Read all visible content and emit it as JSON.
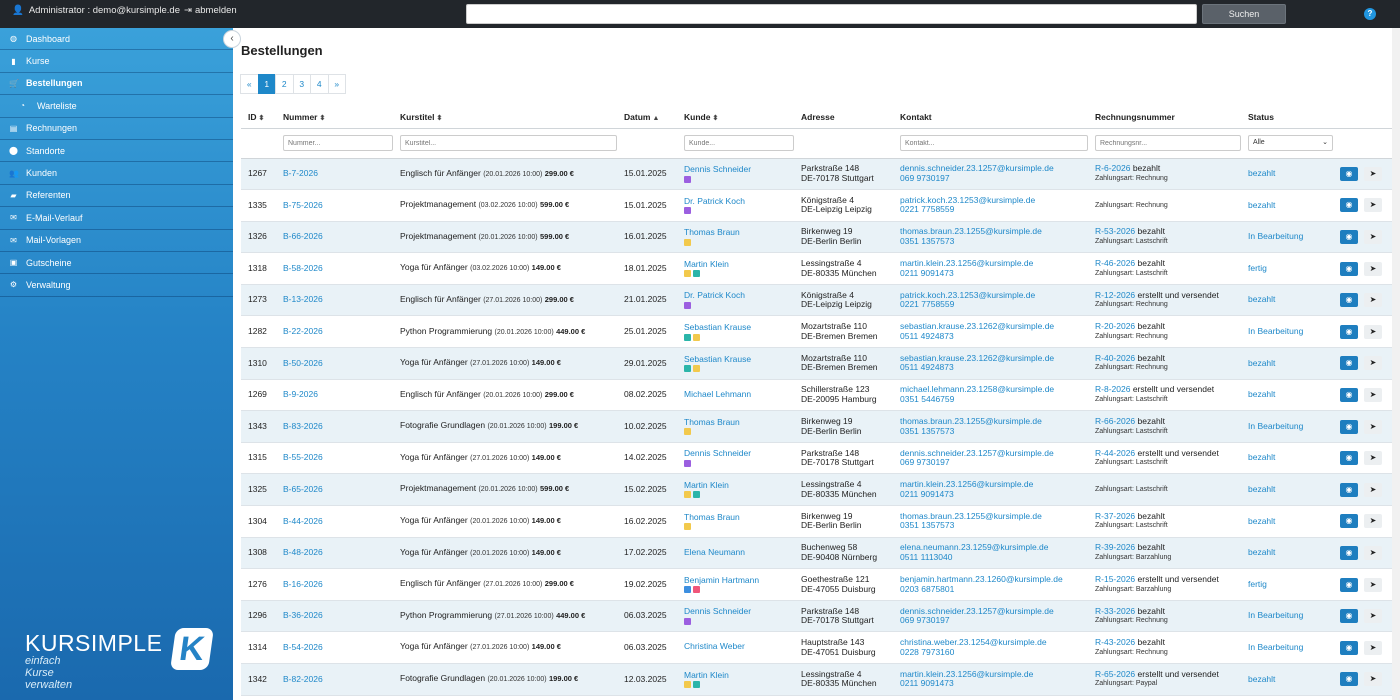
{
  "topbar": {
    "user": "Administrator : demo@kursimple.de",
    "logout": "abmelden",
    "search_value": "",
    "search_button": "Suchen",
    "help": "?"
  },
  "sidebar": {
    "items": [
      {
        "label": "Dashboard",
        "icon": "dashboard-icon",
        "glyph": "◍",
        "active": false,
        "sub": false
      },
      {
        "label": "Kurse",
        "icon": "book-icon",
        "glyph": "▮",
        "active": false,
        "sub": false
      },
      {
        "label": "Bestellungen",
        "icon": "cart-icon",
        "glyph": "🛒",
        "active": true,
        "sub": false
      },
      {
        "label": "Warteliste",
        "icon": "clock-icon",
        "glyph": "◔",
        "active": false,
        "sub": true
      },
      {
        "label": "Rechnungen",
        "icon": "invoice-icon",
        "glyph": "▤",
        "active": false,
        "sub": false
      },
      {
        "label": "Standorte",
        "icon": "location-pin-icon",
        "glyph": "⬤",
        "active": false,
        "sub": false
      },
      {
        "label": "Kunden",
        "icon": "users-icon",
        "glyph": "👥",
        "active": false,
        "sub": false
      },
      {
        "label": "Referenten",
        "icon": "teacher-icon",
        "glyph": "▰",
        "active": false,
        "sub": false
      },
      {
        "label": "E-Mail-Verlauf",
        "icon": "envelope-icon",
        "glyph": "✉",
        "active": false,
        "sub": false
      },
      {
        "label": "Mail-Vorlagen",
        "icon": "mail-template-icon",
        "glyph": "✉",
        "active": false,
        "sub": false
      },
      {
        "label": "Gutscheine",
        "icon": "gift-icon",
        "glyph": "▣",
        "active": false,
        "sub": false
      },
      {
        "label": "Verwaltung",
        "icon": "gear-icon",
        "glyph": "⚙",
        "active": false,
        "sub": false
      }
    ],
    "brand_name": "KURSIMPLE",
    "brand_tagline": "einfach Kurse verwalten",
    "brand_mark": "K"
  },
  "main": {
    "title": "Bestellungen",
    "pagination": [
      "«",
      "1",
      "2",
      "3",
      "4",
      "»"
    ],
    "current_page": "1",
    "columns": [
      "ID",
      "Nummer",
      "Kurstitel",
      "Datum",
      "Kunde",
      "Adresse",
      "Kontakt",
      "Rechnungsnummer",
      "Status"
    ],
    "filters": {
      "nummer": "Nummer...",
      "kurstitel": "Kurstitel...",
      "kunde": "Kunde...",
      "kontakt": "Kontakt...",
      "rechnung": "Rechnungsnr...",
      "status": "Alle"
    },
    "tag_colors": {
      "purple": "#9b5fe0",
      "yellow": "#f2c94c",
      "teal": "#2bb5a9",
      "blue": "#3d8fe0",
      "pink": "#f0567a"
    },
    "rows": [
      {
        "id": "1267",
        "nummer": "B-7-2026",
        "kurs": "Englisch für Anfänger",
        "kurs_datum": "(20.01.2026 10:00)",
        "preis": "299.00 €",
        "datum": "15.01.2025",
        "kunde": "Dennis Schneider",
        "tags": [
          "purple"
        ],
        "strasse": "Parkstraße 148",
        "ort": "DE-70178 Stuttgart",
        "email": "dennis.schneider.23.1257@kursimple.de",
        "telefon": "069 9730197",
        "rechnung": "R-6-2026",
        "rechnung_status": "bezahlt",
        "zahlungsart": "Zahlungsart: Rechnung",
        "status": "bezahlt"
      },
      {
        "id": "1335",
        "nummer": "B-75-2026",
        "kurs": "Projektmanagement",
        "kurs_datum": "(03.02.2026 10:00)",
        "preis": "599.00 €",
        "datum": "15.01.2025",
        "kunde": "Dr. Patrick Koch",
        "tags": [
          "purple"
        ],
        "strasse": "Königstraße 4",
        "ort": "DE-Leipzig Leipzig",
        "email": "patrick.koch.23.1253@kursimple.de",
        "telefon": "0221 7758559",
        "rechnung": "",
        "rechnung_status": "",
        "zahlungsart": "Zahlungsart: Rechnung",
        "status": "bezahlt"
      },
      {
        "id": "1326",
        "nummer": "B-66-2026",
        "kurs": "Projektmanagement",
        "kurs_datum": "(20.01.2026 10:00)",
        "preis": "599.00 €",
        "datum": "16.01.2025",
        "kunde": "Thomas Braun",
        "tags": [
          "yellow"
        ],
        "strasse": "Birkenweg 19",
        "ort": "DE-Berlin Berlin",
        "email": "thomas.braun.23.1255@kursimple.de",
        "telefon": "0351 1357573",
        "rechnung": "R-53-2026",
        "rechnung_status": "bezahlt",
        "zahlungsart": "Zahlungsart: Lastschrift",
        "status": "In Bearbeitung"
      },
      {
        "id": "1318",
        "nummer": "B-58-2026",
        "kurs": "Yoga für Anfänger",
        "kurs_datum": "(03.02.2026 10:00)",
        "preis": "149.00 €",
        "datum": "18.01.2025",
        "kunde": "Martin Klein",
        "tags": [
          "yellow",
          "teal"
        ],
        "strasse": "Lessingstraße 4",
        "ort": "DE-80335 München",
        "email": "martin.klein.23.1256@kursimple.de",
        "telefon": "0211 9091473",
        "rechnung": "R-46-2026",
        "rechnung_status": "bezahlt",
        "zahlungsart": "Zahlungsart: Lastschrift",
        "status": "fertig"
      },
      {
        "id": "1273",
        "nummer": "B-13-2026",
        "kurs": "Englisch für Anfänger",
        "kurs_datum": "(27.01.2026 10:00)",
        "preis": "299.00 €",
        "datum": "21.01.2025",
        "kunde": "Dr. Patrick Koch",
        "tags": [
          "purple"
        ],
        "strasse": "Königstraße 4",
        "ort": "DE-Leipzig Leipzig",
        "email": "patrick.koch.23.1253@kursimple.de",
        "telefon": "0221 7758559",
        "rechnung": "R-12-2026",
        "rechnung_status": "erstellt und versendet",
        "zahlungsart": "Zahlungsart: Rechnung",
        "status": "bezahlt"
      },
      {
        "id": "1282",
        "nummer": "B-22-2026",
        "kurs": "Python Programmierung",
        "kurs_datum": "(20.01.2026 10:00)",
        "preis": "449.00 €",
        "datum": "25.01.2025",
        "kunde": "Sebastian Krause",
        "tags": [
          "teal",
          "yellow"
        ],
        "strasse": "Mozartstraße 110",
        "ort": "DE-Bremen Bremen",
        "email": "sebastian.krause.23.1262@kursimple.de",
        "telefon": "0511 4924873",
        "rechnung": "R-20-2026",
        "rechnung_status": "bezahlt",
        "zahlungsart": "Zahlungsart: Rechnung",
        "status": "In Bearbeitung"
      },
      {
        "id": "1310",
        "nummer": "B-50-2026",
        "kurs": "Yoga für Anfänger",
        "kurs_datum": "(27.01.2026 10:00)",
        "preis": "149.00 €",
        "datum": "29.01.2025",
        "kunde": "Sebastian Krause",
        "tags": [
          "teal",
          "yellow"
        ],
        "strasse": "Mozartstraße 110",
        "ort": "DE-Bremen Bremen",
        "email": "sebastian.krause.23.1262@kursimple.de",
        "telefon": "0511 4924873",
        "rechnung": "R-40-2026",
        "rechnung_status": "bezahlt",
        "zahlungsart": "Zahlungsart: Rechnung",
        "status": "bezahlt"
      },
      {
        "id": "1269",
        "nummer": "B-9-2026",
        "kurs": "Englisch für Anfänger",
        "kurs_datum": "(20.01.2026 10:00)",
        "preis": "299.00 €",
        "datum": "08.02.2025",
        "kunde": "Michael Lehmann",
        "tags": [],
        "strasse": "Schillerstraße 123",
        "ort": "DE-20095 Hamburg",
        "email": "michael.lehmann.23.1258@kursimple.de",
        "telefon": "0351 5446759",
        "rechnung": "R-8-2026",
        "rechnung_status": "erstellt und versendet",
        "zahlungsart": "Zahlungsart: Lastschrift",
        "status": "bezahlt"
      },
      {
        "id": "1343",
        "nummer": "B-83-2026",
        "kurs": "Fotografie Grundlagen",
        "kurs_datum": "(20.01.2026 10:00)",
        "preis": "199.00 €",
        "datum": "10.02.2025",
        "kunde": "Thomas Braun",
        "tags": [
          "yellow"
        ],
        "strasse": "Birkenweg 19",
        "ort": "DE-Berlin Berlin",
        "email": "thomas.braun.23.1255@kursimple.de",
        "telefon": "0351 1357573",
        "rechnung": "R-66-2026",
        "rechnung_status": "bezahlt",
        "zahlungsart": "Zahlungsart: Lastschrift",
        "status": "In Bearbeitung"
      },
      {
        "id": "1315",
        "nummer": "B-55-2026",
        "kurs": "Yoga für Anfänger",
        "kurs_datum": "(27.01.2026 10:00)",
        "preis": "149.00 €",
        "datum": "14.02.2025",
        "kunde": "Dennis Schneider",
        "tags": [
          "purple"
        ],
        "strasse": "Parkstraße 148",
        "ort": "DE-70178 Stuttgart",
        "email": "dennis.schneider.23.1257@kursimple.de",
        "telefon": "069 9730197",
        "rechnung": "R-44-2026",
        "rechnung_status": "erstellt und versendet",
        "zahlungsart": "Zahlungsart: Lastschrift",
        "status": "bezahlt"
      },
      {
        "id": "1325",
        "nummer": "B-65-2026",
        "kurs": "Projektmanagement",
        "kurs_datum": "(20.01.2026 10:00)",
        "preis": "599.00 €",
        "datum": "15.02.2025",
        "kunde": "Martin Klein",
        "tags": [
          "yellow",
          "teal"
        ],
        "strasse": "Lessingstraße 4",
        "ort": "DE-80335 München",
        "email": "martin.klein.23.1256@kursimple.de",
        "telefon": "0211 9091473",
        "rechnung": "",
        "rechnung_status": "",
        "zahlungsart": "Zahlungsart: Lastschrift",
        "status": "bezahlt"
      },
      {
        "id": "1304",
        "nummer": "B-44-2026",
        "kurs": "Yoga für Anfänger",
        "kurs_datum": "(20.01.2026 10:00)",
        "preis": "149.00 €",
        "datum": "16.02.2025",
        "kunde": "Thomas Braun",
        "tags": [
          "yellow"
        ],
        "strasse": "Birkenweg 19",
        "ort": "DE-Berlin Berlin",
        "email": "thomas.braun.23.1255@kursimple.de",
        "telefon": "0351 1357573",
        "rechnung": "R-37-2026",
        "rechnung_status": "bezahlt",
        "zahlungsart": "Zahlungsart: Lastschrift",
        "status": "bezahlt"
      },
      {
        "id": "1308",
        "nummer": "B-48-2026",
        "kurs": "Yoga für Anfänger",
        "kurs_datum": "(20.01.2026 10:00)",
        "preis": "149.00 €",
        "datum": "17.02.2025",
        "kunde": "Elena Neumann",
        "tags": [],
        "strasse": "Buchenweg 58",
        "ort": "DE-90408 Nürnberg",
        "email": "elena.neumann.23.1259@kursimple.de",
        "telefon": "0511 1113040",
        "rechnung": "R-39-2026",
        "rechnung_status": "bezahlt",
        "zahlungsart": "Zahlungsart: Barzahlung",
        "status": "bezahlt"
      },
      {
        "id": "1276",
        "nummer": "B-16-2026",
        "kurs": "Englisch für Anfänger",
        "kurs_datum": "(27.01.2026 10:00)",
        "preis": "299.00 €",
        "datum": "19.02.2025",
        "kunde": "Benjamin Hartmann",
        "tags": [
          "blue",
          "pink"
        ],
        "strasse": "Goethestraße 121",
        "ort": "DE-47055 Duisburg",
        "email": "benjamin.hartmann.23.1260@kursimple.de",
        "telefon": "0203 6875801",
        "rechnung": "R-15-2026",
        "rechnung_status": "erstellt und versendet",
        "zahlungsart": "Zahlungsart: Barzahlung",
        "status": "fertig"
      },
      {
        "id": "1296",
        "nummer": "B-36-2026",
        "kurs": "Python Programmierung",
        "kurs_datum": "(27.01.2026 10:00)",
        "preis": "449.00 €",
        "datum": "06.03.2025",
        "kunde": "Dennis Schneider",
        "tags": [
          "purple"
        ],
        "strasse": "Parkstraße 148",
        "ort": "DE-70178 Stuttgart",
        "email": "dennis.schneider.23.1257@kursimple.de",
        "telefon": "069 9730197",
        "rechnung": "R-33-2026",
        "rechnung_status": "bezahlt",
        "zahlungsart": "Zahlungsart: Rechnung",
        "status": "In Bearbeitung"
      },
      {
        "id": "1314",
        "nummer": "B-54-2026",
        "kurs": "Yoga für Anfänger",
        "kurs_datum": "(27.01.2026 10:00)",
        "preis": "149.00 €",
        "datum": "06.03.2025",
        "kunde": "Christina Weber",
        "tags": [],
        "strasse": "Hauptstraße 143",
        "ort": "DE-47051 Duisburg",
        "email": "christina.weber.23.1254@kursimple.de",
        "telefon": "0228 7973160",
        "rechnung": "R-43-2026",
        "rechnung_status": "bezahlt",
        "zahlungsart": "Zahlungsart: Rechnung",
        "status": "In Bearbeitung"
      },
      {
        "id": "1342",
        "nummer": "B-82-2026",
        "kurs": "Fotografie Grundlagen",
        "kurs_datum": "(20.01.2026 10:00)",
        "preis": "199.00 €",
        "datum": "12.03.2025",
        "kunde": "Martin Klein",
        "tags": [
          "yellow",
          "teal"
        ],
        "strasse": "Lessingstraße 4",
        "ort": "DE-80335 München",
        "email": "martin.klein.23.1256@kursimple.de",
        "telefon": "0211 9091473",
        "rechnung": "R-65-2026",
        "rechnung_status": "erstellt und versendet",
        "zahlungsart": "Zahlungsart: Paypal",
        "status": "bezahlt"
      }
    ]
  }
}
